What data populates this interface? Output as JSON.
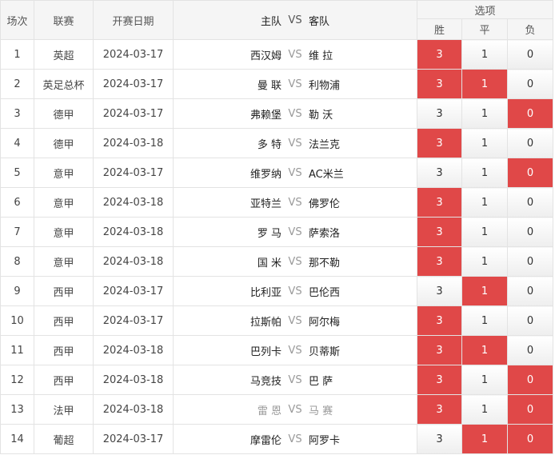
{
  "header": {
    "seq": "场次",
    "league": "联赛",
    "date": "开赛日期",
    "home": "主队",
    "vs": "VS",
    "away": "客队",
    "options": "选项",
    "win": "胜",
    "draw": "平",
    "lose": "负"
  },
  "colors": {
    "selected": "#e04848",
    "border": "#e3e3e3",
    "header_bg": "#f5f5f5"
  },
  "rows": [
    {
      "seq": "1",
      "league": "英超",
      "date": "2024-03-17",
      "home": "西汉姆",
      "away": "维 拉",
      "win": "3",
      "draw": "1",
      "lose": "0",
      "picks": [
        "win"
      ]
    },
    {
      "seq": "2",
      "league": "英足总杯",
      "date": "2024-03-17",
      "home": "曼 联",
      "away": "利物浦",
      "win": "3",
      "draw": "1",
      "lose": "0",
      "picks": [
        "win",
        "draw"
      ]
    },
    {
      "seq": "3",
      "league": "德甲",
      "date": "2024-03-17",
      "home": "弗赖堡",
      "away": "勒 沃",
      "win": "3",
      "draw": "1",
      "lose": "0",
      "picks": [
        "lose"
      ]
    },
    {
      "seq": "4",
      "league": "德甲",
      "date": "2024-03-18",
      "home": "多 特",
      "away": "法兰克",
      "win": "3",
      "draw": "1",
      "lose": "0",
      "picks": [
        "win"
      ]
    },
    {
      "seq": "5",
      "league": "意甲",
      "date": "2024-03-17",
      "home": "维罗纳",
      "away": "AC米兰",
      "win": "3",
      "draw": "1",
      "lose": "0",
      "picks": [
        "lose"
      ]
    },
    {
      "seq": "6",
      "league": "意甲",
      "date": "2024-03-18",
      "home": "亚特兰",
      "away": "佛罗伦",
      "win": "3",
      "draw": "1",
      "lose": "0",
      "picks": [
        "win"
      ]
    },
    {
      "seq": "7",
      "league": "意甲",
      "date": "2024-03-18",
      "home": "罗 马",
      "away": "萨索洛",
      "win": "3",
      "draw": "1",
      "lose": "0",
      "picks": [
        "win"
      ]
    },
    {
      "seq": "8",
      "league": "意甲",
      "date": "2024-03-18",
      "home": "国 米",
      "away": "那不勒",
      "win": "3",
      "draw": "1",
      "lose": "0",
      "picks": [
        "win"
      ]
    },
    {
      "seq": "9",
      "league": "西甲",
      "date": "2024-03-17",
      "home": "比利亚",
      "away": "巴伦西",
      "win": "3",
      "draw": "1",
      "lose": "0",
      "picks": [
        "draw"
      ]
    },
    {
      "seq": "10",
      "league": "西甲",
      "date": "2024-03-17",
      "home": "拉斯帕",
      "away": "阿尔梅",
      "win": "3",
      "draw": "1",
      "lose": "0",
      "picks": [
        "win"
      ]
    },
    {
      "seq": "11",
      "league": "西甲",
      "date": "2024-03-18",
      "home": "巴列卡",
      "away": "贝蒂斯",
      "win": "3",
      "draw": "1",
      "lose": "0",
      "picks": [
        "win",
        "draw"
      ]
    },
    {
      "seq": "12",
      "league": "西甲",
      "date": "2024-03-18",
      "home": "马竞技",
      "away": "巴 萨",
      "win": "3",
      "draw": "1",
      "lose": "0",
      "picks": [
        "win",
        "lose"
      ]
    },
    {
      "seq": "13",
      "league": "法甲",
      "date": "2024-03-18",
      "home": "雷 恩",
      "away": "马 赛",
      "win": "3",
      "draw": "1",
      "lose": "0",
      "picks": [
        "win",
        "lose"
      ],
      "muted": true
    },
    {
      "seq": "14",
      "league": "葡超",
      "date": "2024-03-17",
      "home": "摩雷伦",
      "away": "阿罗卡",
      "win": "3",
      "draw": "1",
      "lose": "0",
      "picks": [
        "draw",
        "lose"
      ]
    }
  ]
}
